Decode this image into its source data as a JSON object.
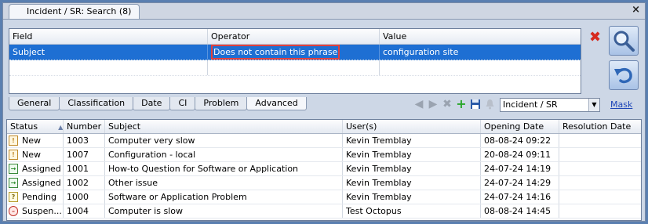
{
  "window": {
    "tab_title": "Incident / SR: Search (8)",
    "close_symbol": "×"
  },
  "criteria": {
    "columns": [
      "Field",
      "Operator",
      "Value"
    ],
    "rows": [
      {
        "field": "Subject",
        "operator": "Does not contain this phrase",
        "value": "configuration site"
      }
    ]
  },
  "criteria_tabs": [
    "General",
    "Classification",
    "Date",
    "CI",
    "Problem",
    "Advanced"
  ],
  "active_criteria_tab": "Advanced",
  "toolbar": {
    "module_select": "Incident / SR",
    "mask_link": "Mask"
  },
  "results": {
    "columns": [
      "Status",
      "Number",
      "Subject",
      "User(s)",
      "Opening Date",
      "Resolution Date"
    ],
    "rows": [
      {
        "status": "New",
        "status_kind": "new",
        "number": "1003",
        "subject": "Computer very slow",
        "user": "Kevin Tremblay",
        "opening": "08-08-24 09:22",
        "resolution": ""
      },
      {
        "status": "New",
        "status_kind": "new",
        "number": "1007",
        "subject": "Configuration -  local",
        "user": "Kevin Tremblay",
        "opening": "20-08-24 09:11",
        "resolution": ""
      },
      {
        "status": "Assigned",
        "status_kind": "assigned",
        "number": "1001",
        "subject": "How-to Question for Software or Application",
        "user": "Kevin Tremblay",
        "opening": "24-07-24 14:19",
        "resolution": ""
      },
      {
        "status": "Assigned",
        "status_kind": "assigned",
        "number": "1002",
        "subject": "Other issue",
        "user": "Kevin Tremblay",
        "opening": "24-07-24 14:29",
        "resolution": ""
      },
      {
        "status": "Pending",
        "status_kind": "pending",
        "number": "1000",
        "subject": "Software or Application Problem",
        "user": "Kevin Tremblay",
        "opening": "24-07-24 14:16",
        "resolution": ""
      },
      {
        "status": "Suspen...",
        "status_kind": "suspended",
        "number": "1004",
        "subject": "Computer is slow",
        "user": "Test Octopus",
        "opening": "08-08-24 14:45",
        "resolution": ""
      }
    ]
  },
  "colors": {
    "selection": "#1e6fd3",
    "highlight_outline": "#e0403e",
    "delete_red": "#d62a1e",
    "link_blue": "#1f47b8"
  }
}
